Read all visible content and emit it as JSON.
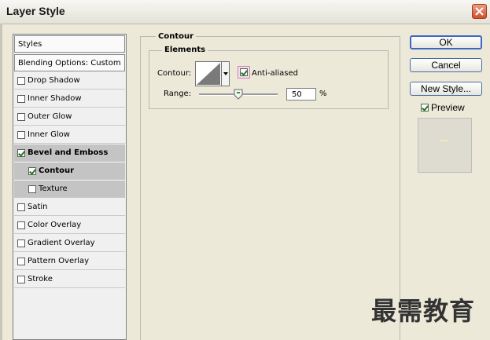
{
  "window": {
    "title": "Layer Style"
  },
  "styles_list": {
    "header": "Styles",
    "blending": "Blending Options: Custom",
    "items": [
      {
        "label": "Drop Shadow",
        "checked": false,
        "bold": false,
        "child": false,
        "selected": false
      },
      {
        "label": "Inner Shadow",
        "checked": false,
        "bold": false,
        "child": false,
        "selected": false
      },
      {
        "label": "Outer Glow",
        "checked": false,
        "bold": false,
        "child": false,
        "selected": false
      },
      {
        "label": "Inner Glow",
        "checked": false,
        "bold": false,
        "child": false,
        "selected": false
      },
      {
        "label": "Bevel and Emboss",
        "checked": true,
        "bold": true,
        "child": false,
        "selected": true
      },
      {
        "label": "Contour",
        "checked": true,
        "bold": true,
        "child": true,
        "selected": true
      },
      {
        "label": "Texture",
        "checked": false,
        "bold": false,
        "child": true,
        "selected": true
      },
      {
        "label": "Satin",
        "checked": false,
        "bold": false,
        "child": false,
        "selected": false
      },
      {
        "label": "Color Overlay",
        "checked": false,
        "bold": false,
        "child": false,
        "selected": false
      },
      {
        "label": "Gradient Overlay",
        "checked": false,
        "bold": false,
        "child": false,
        "selected": false
      },
      {
        "label": "Pattern Overlay",
        "checked": false,
        "bold": false,
        "child": false,
        "selected": false
      },
      {
        "label": "Stroke",
        "checked": false,
        "bold": false,
        "child": false,
        "selected": false
      }
    ]
  },
  "contour_panel": {
    "title": "Contour",
    "elements_title": "Elements",
    "contour_label": "Contour:",
    "anti_aliased_label": "Anti-aliased",
    "anti_aliased_checked": true,
    "range_label": "Range:",
    "range_value": "50",
    "range_unit": "%",
    "range_fraction": 0.5
  },
  "buttons": {
    "ok": "OK",
    "cancel": "Cancel",
    "new_style": "New Style..."
  },
  "preview": {
    "label": "Preview",
    "checked": true
  },
  "watermark": "最需教育",
  "colors": {
    "accent": "#3d66c4",
    "selection": "#c4c4c4",
    "close": "#d0502e"
  }
}
